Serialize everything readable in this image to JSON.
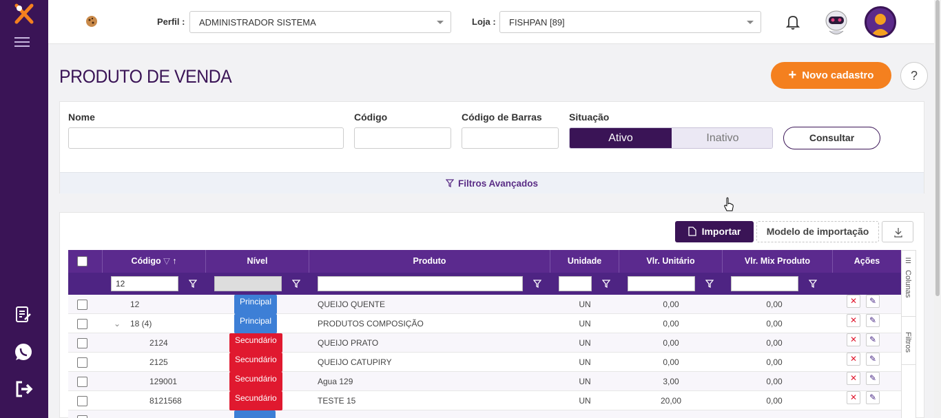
{
  "header": {
    "perfil_label": "Perfil :",
    "perfil_value": "ADMINISTRADOR SISTEMA",
    "loja_label": "Loja :",
    "loja_value": "FISHPAN [89]"
  },
  "page": {
    "title": "PRODUTO DE VENDA",
    "new_button": "Novo cadastro",
    "help": "?"
  },
  "filters": {
    "nome_label": "Nome",
    "codigo_label": "Código",
    "codigo_barras_label": "Código de Barras",
    "situacao_label": "Situação",
    "ativo": "Ativo",
    "inativo": "Inativo",
    "consultar": "Consultar",
    "advanced": "Filtros Avançados"
  },
  "toolbar": {
    "importar": "Importar",
    "modelo": "Modelo de importação"
  },
  "grid": {
    "columns": [
      "Código",
      "Nível",
      "Produto",
      "Unidade",
      "Vlr. Unitário",
      "Vlr. Mix Produto",
      "Ações"
    ],
    "codigo_filter_value": "12",
    "rows": [
      {
        "codigo": "12",
        "nivel": "Principal",
        "produto": "QUEIJO QUENTE",
        "unidade": "UN",
        "vlr_unitario": "0,00",
        "vlr_mix": "0,00"
      },
      {
        "codigo": "18 (4)",
        "nivel": "Principal",
        "produto": "PRODUTOS COMPOSIÇÃO",
        "unidade": "UN",
        "vlr_unitario": "0,00",
        "vlr_mix": "0,00"
      },
      {
        "codigo": "2124",
        "nivel": "Secundário",
        "produto": "QUEIJO PRATO",
        "unidade": "UN",
        "vlr_unitario": "0,00",
        "vlr_mix": "0,00"
      },
      {
        "codigo": "2125",
        "nivel": "Secundário",
        "produto": "QUEIJO CATUPIRY",
        "unidade": "UN",
        "vlr_unitario": "0,00",
        "vlr_mix": "0,00"
      },
      {
        "codigo": "129001",
        "nivel": "Secundário",
        "produto": "Agua 129",
        "unidade": "UN",
        "vlr_unitario": "3,00",
        "vlr_mix": "0,00"
      },
      {
        "codigo": "8121568",
        "nivel": "Secundário",
        "produto": "TESTE 15",
        "unidade": "UN",
        "vlr_unitario": "20,00",
        "vlr_mix": "0,00"
      }
    ],
    "side_tabs": [
      "Colunas",
      "Filtros"
    ]
  },
  "colors": {
    "sidebar": "#3a1456",
    "accent_orange": "#f4801f",
    "grid_header": "#5b2a8e",
    "badge_principal": "#3d7fd6",
    "badge_secundario": "#e0192f"
  }
}
